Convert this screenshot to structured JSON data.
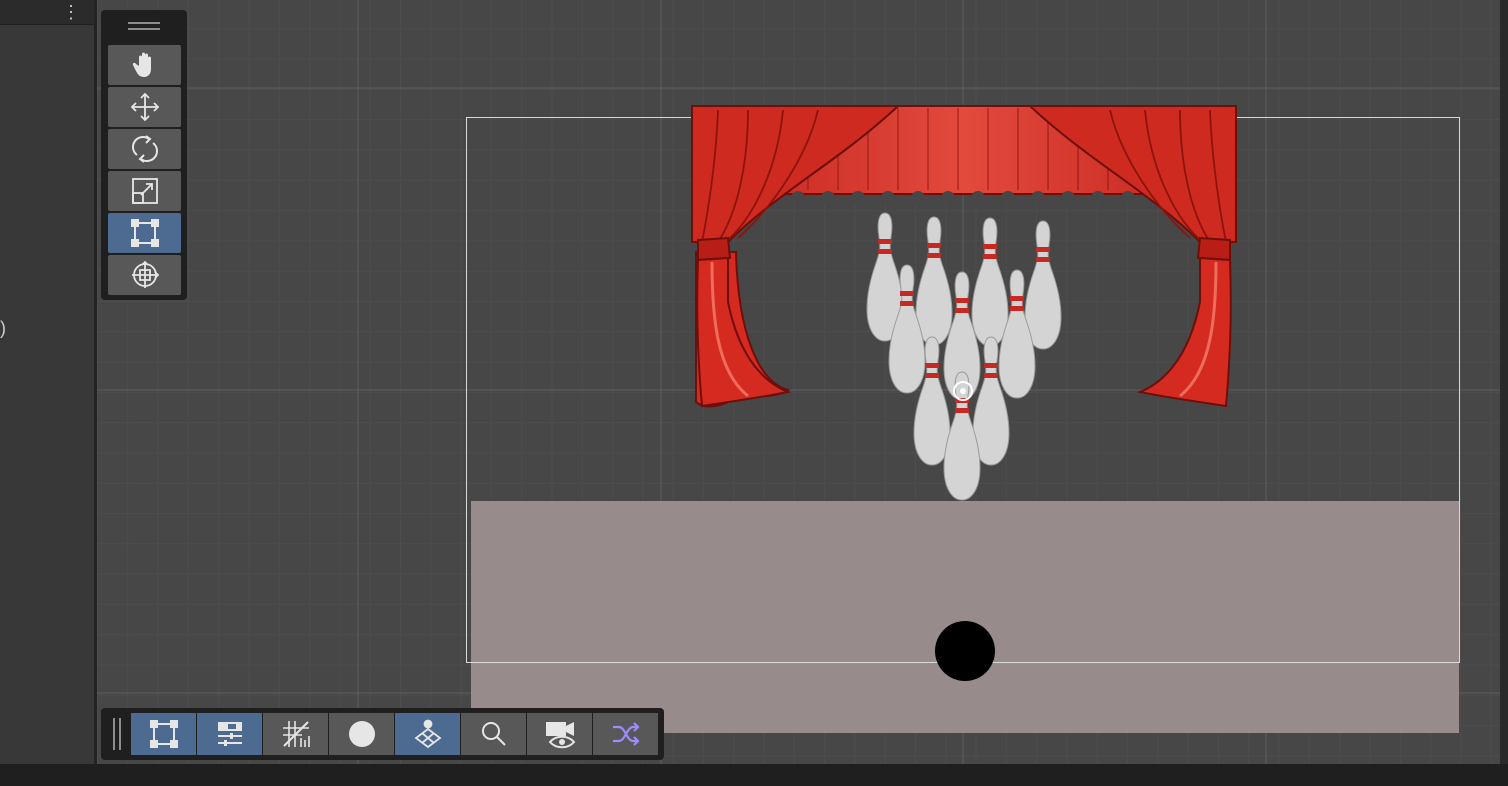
{
  "left_panel": {
    "menu_icon": "kebab-menu-icon",
    "partial_text": ")"
  },
  "tool_palette": {
    "tools": [
      {
        "name": "hand-tool",
        "icon": "hand-icon",
        "active": false
      },
      {
        "name": "move-tool",
        "icon": "move-arrows-icon",
        "active": false
      },
      {
        "name": "rotate-tool",
        "icon": "rotate-icon",
        "active": false
      },
      {
        "name": "scale-tool",
        "icon": "scale-icon",
        "active": false
      },
      {
        "name": "rect-tool",
        "icon": "rect-transform-icon",
        "active": true
      },
      {
        "name": "transform-tool",
        "icon": "transform-gizmo-icon",
        "active": false
      }
    ]
  },
  "bottom_toolbar": {
    "tools": [
      {
        "name": "rect-toggle",
        "icon": "rect-transform-icon",
        "active": true
      },
      {
        "name": "align-toggle",
        "icon": "align-sliders-icon",
        "active": true
      },
      {
        "name": "grid-snap",
        "icon": "grid-snap-icon",
        "active": false
      },
      {
        "name": "draw-mode",
        "icon": "circle-icon",
        "active": false
      },
      {
        "name": "scene-visibility",
        "icon": "layers-person-icon",
        "active": true
      },
      {
        "name": "search",
        "icon": "search-icon",
        "active": false
      },
      {
        "name": "camera-view",
        "icon": "camera-eye-icon",
        "active": false
      },
      {
        "name": "shuffle",
        "icon": "shuffle-icon",
        "active": false
      }
    ]
  },
  "colors": {
    "active_tool": "#4d6b91",
    "curtain": "#d42a20",
    "floor": "#978b8b",
    "shuffle_icon": "#9b8cff"
  },
  "scene": {
    "objects": [
      "curtain",
      "bowling-pins",
      "floor",
      "ball"
    ]
  }
}
